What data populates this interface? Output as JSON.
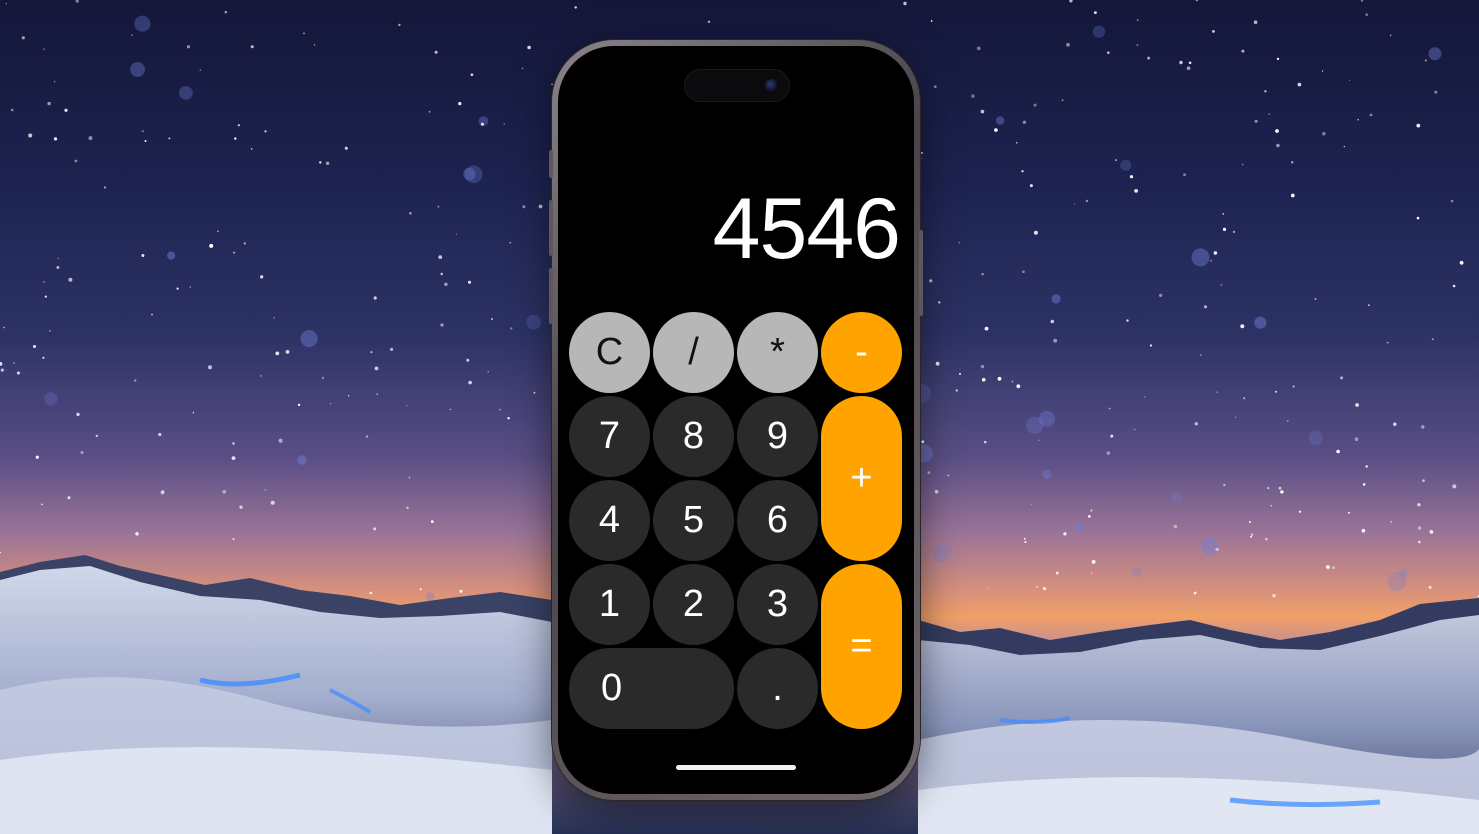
{
  "display": {
    "value": "4546"
  },
  "keys": {
    "clear": "C",
    "divide": "/",
    "multiply": "*",
    "subtract": "-",
    "add": "+",
    "equals": "=",
    "decimal": ".",
    "d0": "0",
    "d1": "1",
    "d2": "2",
    "d3": "3",
    "d4": "4",
    "d5": "5",
    "d6": "6",
    "d7": "7",
    "d8": "8",
    "d9": "9"
  },
  "colors": {
    "operator": "#ffa300",
    "function": "#b7b7b7",
    "digit": "#2a2a2a",
    "screen": "#000000"
  }
}
